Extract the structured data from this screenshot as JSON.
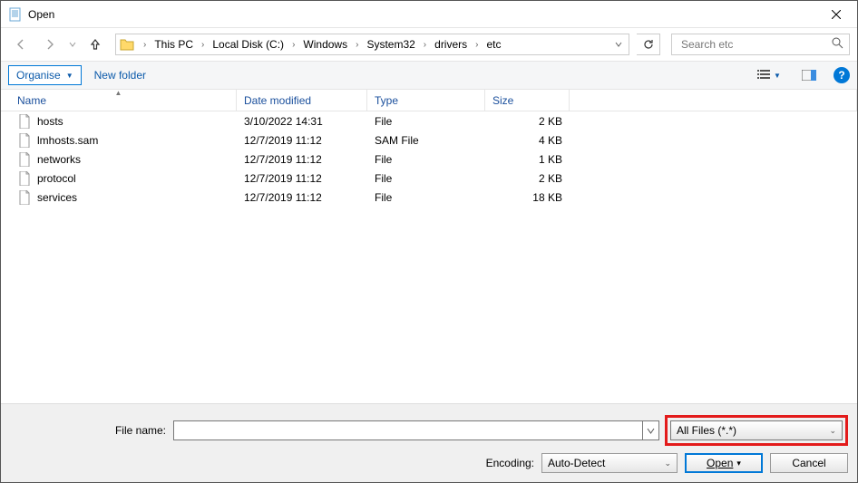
{
  "window": {
    "title": "Open"
  },
  "nav": {
    "breadcrumbs": [
      "This PC",
      "Local Disk (C:)",
      "Windows",
      "System32",
      "drivers",
      "etc"
    ],
    "search_placeholder": "Search etc"
  },
  "toolbar": {
    "organise_label": "Organise",
    "newfolder_label": "New folder"
  },
  "columns": {
    "name": "Name",
    "date": "Date modified",
    "type": "Type",
    "size": "Size"
  },
  "files": [
    {
      "name": "hosts",
      "date": "3/10/2022 14:31",
      "type": "File",
      "size": "2 KB"
    },
    {
      "name": "lmhosts.sam",
      "date": "12/7/2019 11:12",
      "type": "SAM File",
      "size": "4 KB"
    },
    {
      "name": "networks",
      "date": "12/7/2019 11:12",
      "type": "File",
      "size": "1 KB"
    },
    {
      "name": "protocol",
      "date": "12/7/2019 11:12",
      "type": "File",
      "size": "2 KB"
    },
    {
      "name": "services",
      "date": "12/7/2019 11:12",
      "type": "File",
      "size": "18 KB"
    }
  ],
  "bottom": {
    "filename_label": "File name:",
    "filename_value": "",
    "filter_label": "All Files  (*.*)",
    "encoding_label": "Encoding:",
    "encoding_value": "Auto-Detect",
    "open_label": "Open",
    "cancel_label": "Cancel"
  }
}
